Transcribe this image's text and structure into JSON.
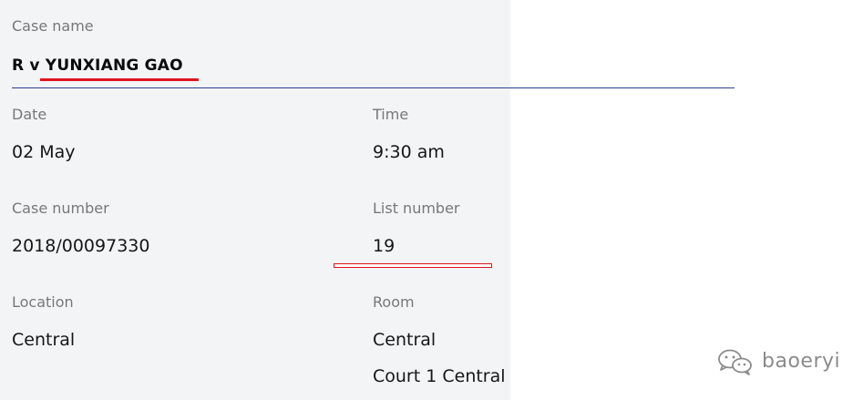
{
  "case": {
    "name_label": "Case name",
    "name_value": "R v YUNXIANG GAO",
    "date_label": "Date",
    "date_value": "02 May",
    "time_label": "Time",
    "time_value": "9:30 am",
    "number_label": "Case number",
    "number_value": "2018/00097330",
    "list_label": "List number",
    "list_value": "19",
    "location_label": "Location",
    "location_value": "Central",
    "room_label": "Room",
    "room_value_1": "Central",
    "room_value_2": "Court 1 Central"
  },
  "watermark": {
    "text": "baoeryi",
    "icon": "wechat-icon"
  },
  "colors": {
    "panel_bg": "#f3f4f6",
    "rule": "#2b3f8f",
    "highlight": "#e0141d"
  }
}
